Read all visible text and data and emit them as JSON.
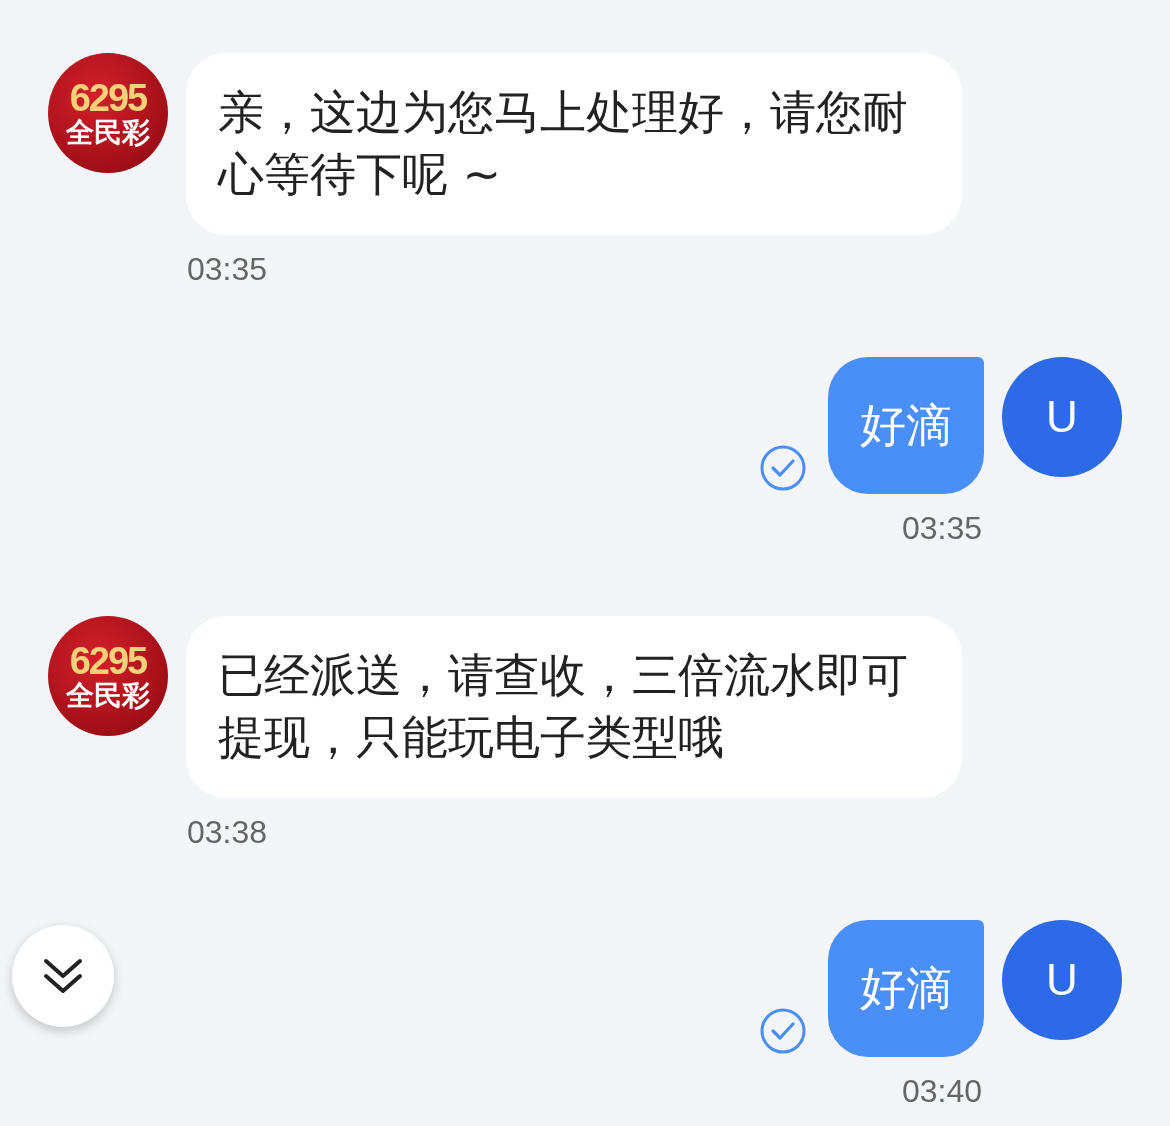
{
  "messages": [
    {
      "kind": "agent",
      "avatar": {
        "lines": [
          "6295",
          "全民彩"
        ]
      },
      "text": "亲，这边为您马上处理好，请您耐心等待下呢 ~",
      "time": "03:35"
    },
    {
      "kind": "user",
      "avatar": {
        "lines": [
          "U"
        ]
      },
      "text": "好滴",
      "time": "03:35",
      "delivered": true
    },
    {
      "kind": "agent",
      "avatar": {
        "lines": [
          "6295",
          "全民彩"
        ]
      },
      "text": "已经派送，请查收，三倍流水即可提现，只能玩电子类型哦",
      "time": "03:38"
    },
    {
      "kind": "user",
      "avatar": {
        "lines": [
          "U"
        ]
      },
      "text": "好滴",
      "time": "03:40",
      "delivered": true
    }
  ]
}
